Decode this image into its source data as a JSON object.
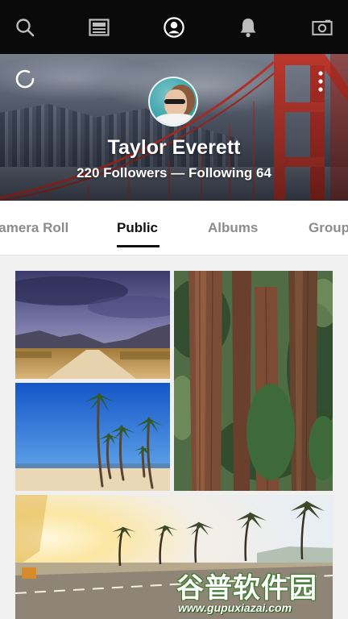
{
  "nav": {
    "icons": [
      "search-icon",
      "feed-icon",
      "profile-icon",
      "bell-icon",
      "camera-icon"
    ],
    "active": "profile-icon"
  },
  "profile": {
    "name": "Taylor Everett",
    "followers_line": "220 Followers — Following 64"
  },
  "tabs": [
    {
      "label": "Camera Roll",
      "active": false
    },
    {
      "label": "Public",
      "active": true
    },
    {
      "label": "Albums",
      "active": false
    },
    {
      "label": "Groups",
      "active": false
    }
  ],
  "watermark": {
    "name": "谷普软件园",
    "url": "www.gupuxiazai.com"
  },
  "colors": {
    "topbar": "#0a0a0a",
    "bridge": "#c8362c",
    "avatar_bg": "#3aa6ad",
    "tab_active": "#111111",
    "tab_inactive": "#8c8c8c"
  }
}
